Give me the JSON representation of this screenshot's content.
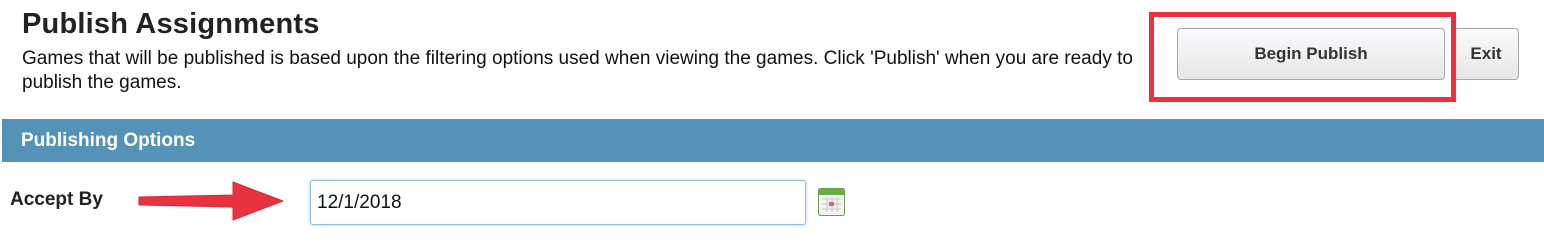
{
  "page": {
    "title": "Publish Assignments",
    "description": "Games that will be published is based upon the filtering options used when viewing the games. Click 'Publish' when you are ready to publish the games."
  },
  "actions": {
    "begin_publish_label": "Begin Publish",
    "exit_label": "Exit"
  },
  "section": {
    "title": "Publishing Options"
  },
  "fields": {
    "accept_by": {
      "label": "Accept By",
      "value": "12/1/2018"
    }
  },
  "icons": {
    "calendar": "calendar-icon",
    "annotation_arrow": "arrow-right-icon"
  },
  "colors": {
    "section_bar": "#5592b8",
    "annotation_red": "#e8333f",
    "input_focus_border": "#8fbde8"
  }
}
